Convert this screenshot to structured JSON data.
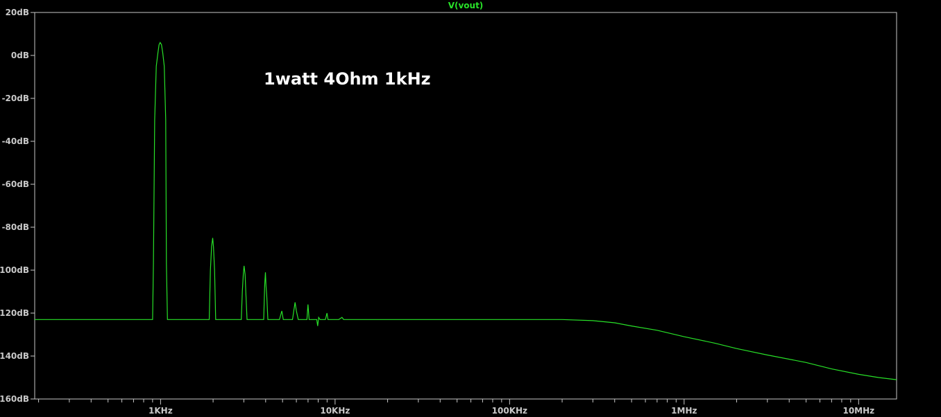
{
  "colors": {
    "background": "#000000",
    "frame": "#c8c8c8",
    "trace": "#28e228",
    "annotation": "#ffffff"
  },
  "chart_data": {
    "type": "line",
    "title": "V(vout)",
    "annotation": "1watt 4Ohm 1kHz",
    "xlabel": "",
    "ylabel": "",
    "x_scale": "log",
    "xlim": [
      190,
      16500000
    ],
    "ylim": [
      -160,
      20
    ],
    "grid": false,
    "x_ticks": [
      {
        "value": 1000,
        "label": "1KHz"
      },
      {
        "value": 10000,
        "label": "10KHz"
      },
      {
        "value": 100000,
        "label": "100KHz"
      },
      {
        "value": 1000000,
        "label": "1MHz"
      },
      {
        "value": 10000000,
        "label": "10MHz"
      }
    ],
    "y_ticks": [
      {
        "value": 20,
        "label": "20dB"
      },
      {
        "value": 0,
        "label": "0dB"
      },
      {
        "value": -20,
        "label": "-20dB"
      },
      {
        "value": -40,
        "label": "-40dB"
      },
      {
        "value": -60,
        "label": "-60dB"
      },
      {
        "value": -80,
        "label": "-80dB"
      },
      {
        "value": -100,
        "label": "-100dB"
      },
      {
        "value": -120,
        "label": "-120dB"
      },
      {
        "value": -140,
        "label": "-140dB"
      },
      {
        "value": -160,
        "label": "-160dB"
      }
    ],
    "series": [
      {
        "x": [
          190,
          900,
          910,
          925,
          945,
          965,
          980,
          995,
          1012,
          1030,
          1050,
          1070,
          1080,
          1095,
          1110,
          1900,
          1930,
          1960,
          1990,
          2010,
          2040,
          2070,
          2100,
          2900,
          2940,
          2980,
          3010,
          3050,
          3080,
          3130,
          3900,
          3950,
          3990,
          4020,
          4060,
          4120,
          4800,
          4950,
          5050,
          5150,
          5700,
          5900,
          6000,
          6150,
          6900,
          6990,
          7100,
          7850,
          7950,
          8050,
          8200,
          8800,
          8990,
          9100,
          9500,
          10000,
          10500,
          10950,
          11200,
          12000,
          20000,
          50000,
          100000,
          150000,
          200000,
          300000,
          400000,
          500000,
          700000,
          1000000,
          1500000,
          2000000,
          3000000,
          5000000,
          7000000,
          10000000,
          13000000,
          16500000
        ],
        "y": [
          -123,
          -123,
          -97,
          -30,
          -5,
          1,
          5,
          6,
          5,
          1,
          -5,
          -30,
          -97,
          -123,
          -123,
          -123,
          -100,
          -89,
          -85,
          -89,
          -100,
          -123,
          -123,
          -123,
          -110,
          -102,
          -98,
          -102,
          -110,
          -123,
          -123,
          -107,
          -101,
          -107,
          -112,
          -123,
          -123,
          -119,
          -123,
          -123,
          -123,
          -115,
          -119,
          -123,
          -123,
          -116,
          -123,
          -123,
          -126,
          -122,
          -123,
          -123,
          -120,
          -123,
          -123,
          -123,
          -123,
          -122,
          -123,
          -123,
          -123,
          -123,
          -123,
          -123,
          -123,
          -123.5,
          -124.5,
          -126,
          -128,
          -131,
          -134,
          -136.5,
          -139.5,
          -143,
          -146,
          -148.5,
          -150,
          -151
        ]
      }
    ]
  }
}
